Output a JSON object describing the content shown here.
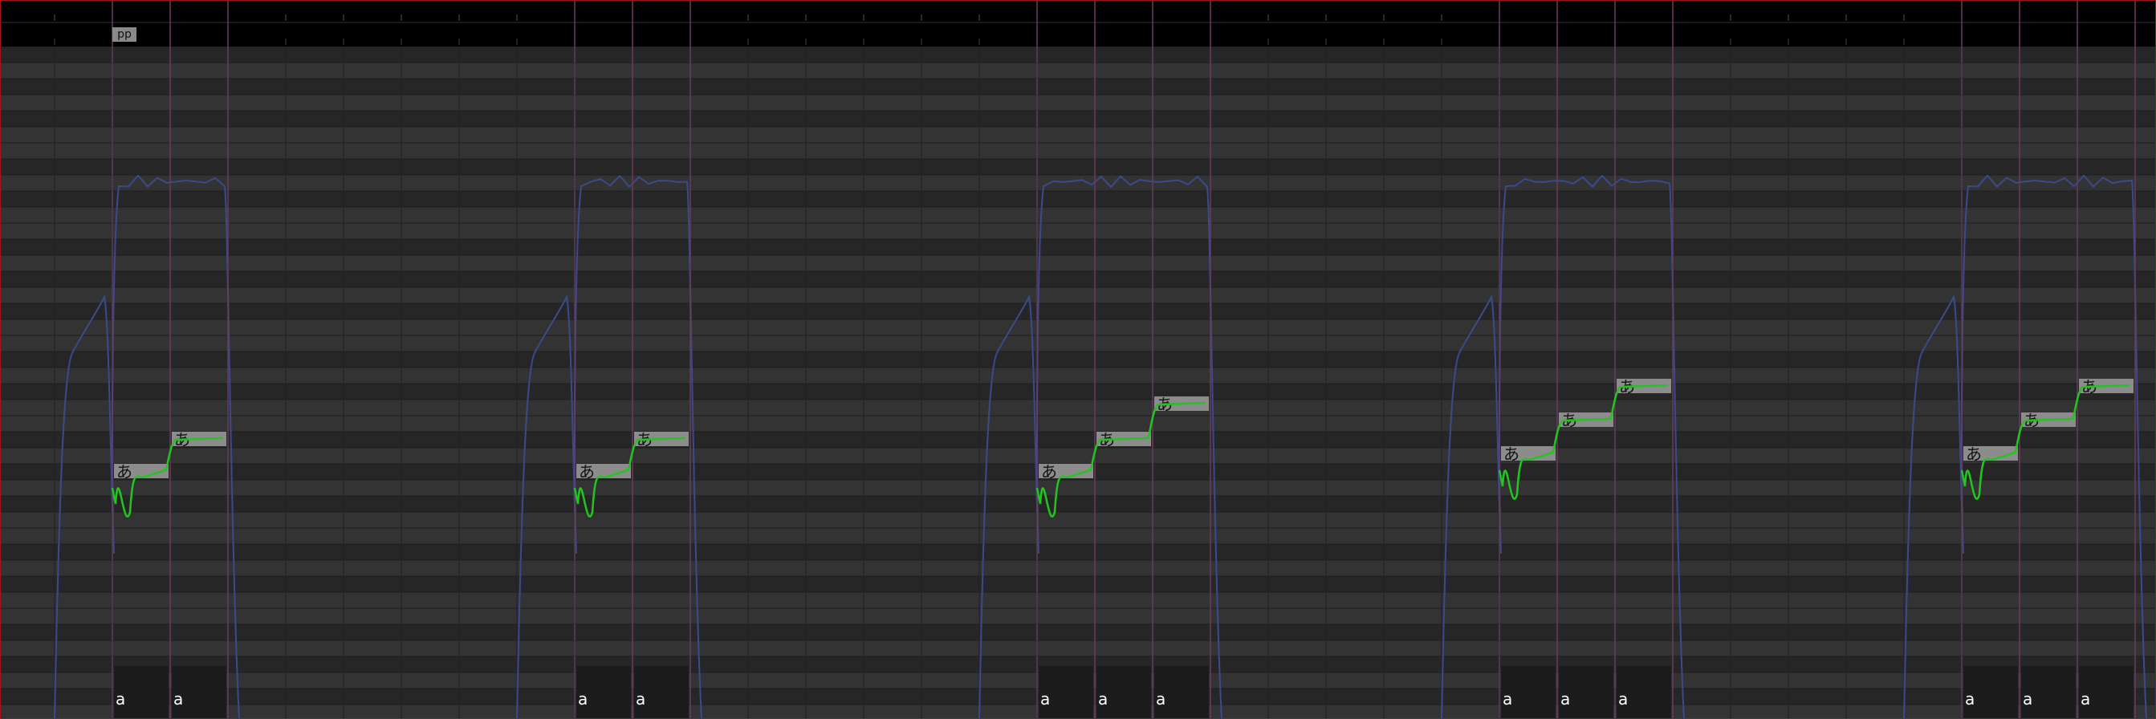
{
  "editor": {
    "dynamics_marker": "pp",
    "phrases": [
      {
        "notes": [
          {
            "lyric": "あ",
            "phoneme": "a"
          },
          {
            "lyric": "あ",
            "phoneme": "a"
          }
        ]
      },
      {
        "notes": [
          {
            "lyric": "あ",
            "phoneme": "a"
          },
          {
            "lyric": "あ",
            "phoneme": "a"
          }
        ]
      },
      {
        "notes": [
          {
            "lyric": "あ",
            "phoneme": "a"
          },
          {
            "lyric": "あ",
            "phoneme": "a"
          },
          {
            "lyric": "あ",
            "phoneme": "a"
          }
        ]
      },
      {
        "notes": [
          {
            "lyric": "あ",
            "phoneme": "a"
          },
          {
            "lyric": "あ",
            "phoneme": "a"
          },
          {
            "lyric": "あ",
            "phoneme": "a"
          }
        ]
      },
      {
        "notes": [
          {
            "lyric": "あ",
            "phoneme": "a"
          },
          {
            "lyric": "あ",
            "phoneme": "a"
          },
          {
            "lyric": "あ",
            "phoneme": "a"
          }
        ]
      }
    ]
  },
  "colors": {
    "background": "#2c2c2c",
    "ruler": "#000000",
    "black_key_row": "#262626",
    "white_key_row": "#333333",
    "measure_line": "#6a3a5e",
    "note_fill": "#8c8c8c",
    "pitch_curve": "#22c51f",
    "dynamics_curve": "#3a4a8c",
    "frame": "#a0141c"
  }
}
